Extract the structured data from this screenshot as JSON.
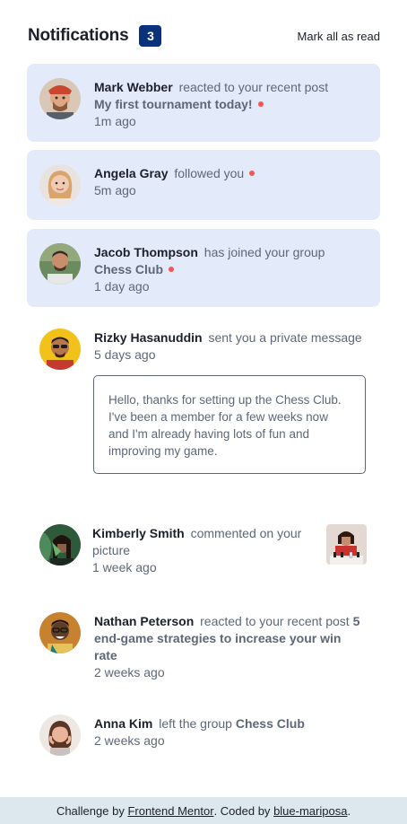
{
  "header": {
    "title": "Notifications",
    "unread_count": "3",
    "mark_all": "Mark all as read"
  },
  "notifications": [
    {
      "actor": "Mark Webber",
      "action": "reacted to your recent post",
      "target": "My first tournament today!",
      "time": "1m ago",
      "unread": true
    },
    {
      "actor": "Angela Gray",
      "action": "followed you",
      "time": "5m ago",
      "unread": true
    },
    {
      "actor": "Jacob Thompson",
      "action": "has joined your group",
      "target": "Chess Club",
      "time": "1 day ago",
      "unread": true
    },
    {
      "actor": "Rizky Hasanuddin",
      "action": "sent you a private message",
      "time": "5 days ago",
      "message": "Hello, thanks for setting up the Chess Club. I've been a member for a few weeks now and I'm already having lots of fun and improving my game.",
      "unread": false
    },
    {
      "actor": "Kimberly Smith",
      "action": "commented on your picture",
      "time": "1 week ago",
      "unread": false
    },
    {
      "actor": "Nathan Peterson",
      "action": "reacted to your recent post",
      "target": "5 end-game strategies to increase your win rate",
      "time": "2 weeks ago",
      "unread": false
    },
    {
      "actor": "Anna Kim",
      "action": "left the group",
      "target": "Chess Club",
      "time": "2 weeks ago",
      "unread": false
    }
  ],
  "footer": {
    "prefix": "Challenge by",
    "link1": "Frontend Mentor",
    "middle": ". Coded by",
    "link2": "blue-mariposa",
    "suffix": "."
  },
  "colors": {
    "unread_bg": "#e3ebfa",
    "badge": "#0a327b",
    "dot": "#f65552",
    "dark_text": "#1c202b",
    "muted_text": "#5e6778",
    "footer_bg": "#dde7ee"
  }
}
